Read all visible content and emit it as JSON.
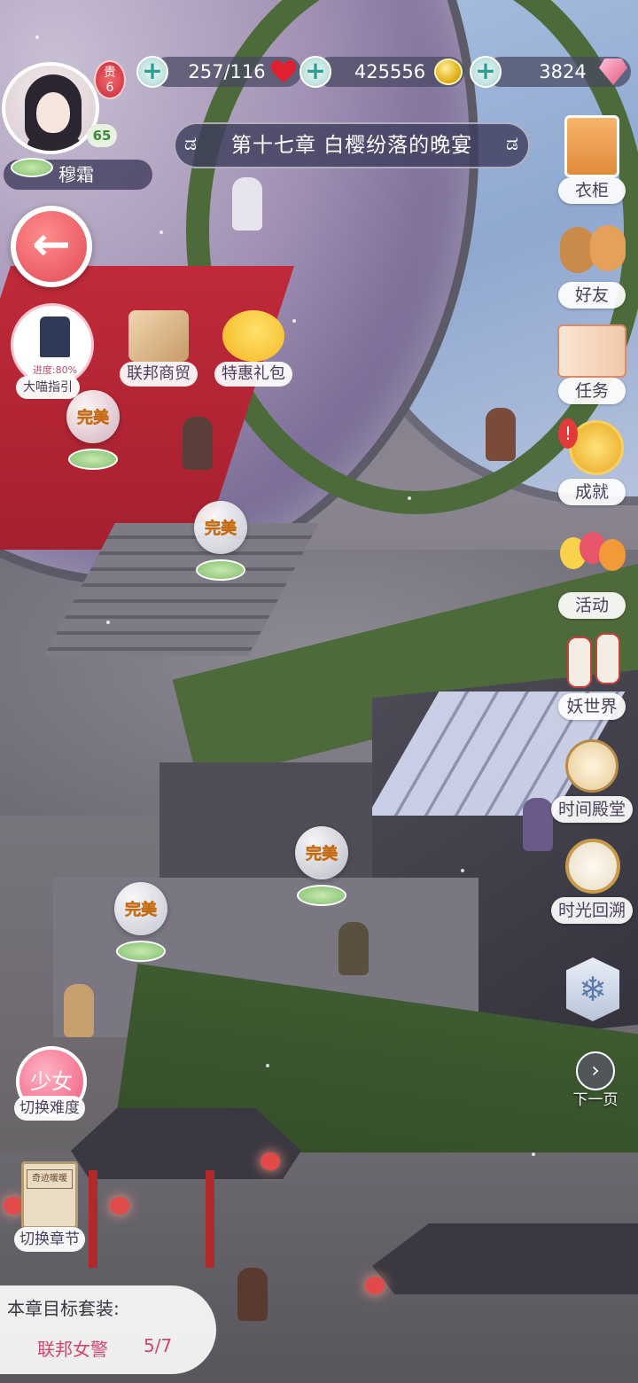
{
  "player": {
    "name": "穆霜",
    "level": "65",
    "vip": "贵\n6"
  },
  "resources": {
    "stamina": "257/116",
    "coins": "425556",
    "diamonds": "3824"
  },
  "chapter": {
    "title": "第十七章 白樱纷落的晚宴"
  },
  "guide": {
    "progress": "进度:80%",
    "label": "大喵指引"
  },
  "shops": {
    "federation": "联邦商贸",
    "gift": "特惠礼包"
  },
  "side_menu": [
    {
      "label": "衣柜",
      "icon": "wardrobe-icon"
    },
    {
      "label": "好友",
      "icon": "friends-icon"
    },
    {
      "label": "任务",
      "icon": "task-book-icon"
    },
    {
      "label": "成就",
      "icon": "achievement-medal-icon"
    },
    {
      "label": "活动",
      "icon": "balloons-icon"
    },
    {
      "label": "妖世界",
      "icon": "lantern-icon"
    },
    {
      "label": "时间殿堂",
      "icon": "compass-icon"
    },
    {
      "label": "时光回溯",
      "icon": "clock-icon"
    }
  ],
  "markers": {
    "perfect": "完美"
  },
  "difficulty": {
    "value": "少女",
    "label": "切换难度"
  },
  "chapter_switch": {
    "label": "切换章节",
    "book_title": "奇迹暖暖"
  },
  "next_page": {
    "label": "下一页"
  },
  "goal": {
    "heading": "本章目标套装:",
    "suit": "联邦女警",
    "progress": "5/7"
  },
  "colors": {
    "accent_red": "#e24b58",
    "perfect_orange": "#f6a13a",
    "hud_bg": "#46465f"
  }
}
